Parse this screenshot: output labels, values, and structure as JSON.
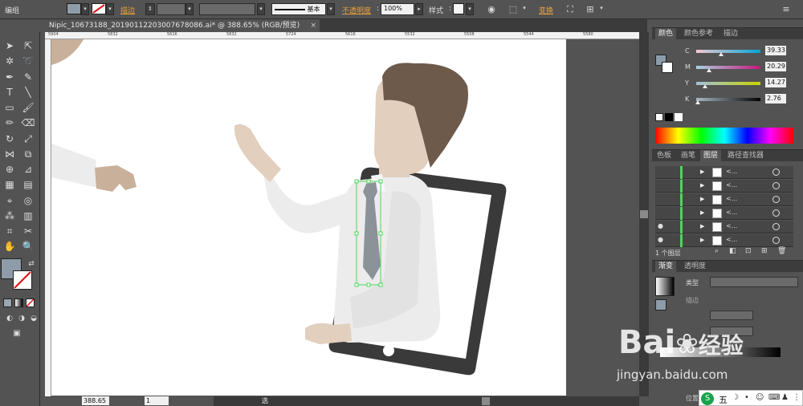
{
  "control_bar": {
    "group_label": "编组",
    "stroke_label": "描边",
    "stroke_style": "基本",
    "opacity_label": "不透明度",
    "opacity_value": "100%",
    "style_label": "样式",
    "transform_label": "变换",
    "fill_color": "#8d9ca8"
  },
  "document": {
    "tab_title": "Nipic_10673188_20190112203007678086.ai* @ 388.65% (RGB/预览)",
    "close_glyph": "×"
  },
  "ruler": {
    "ticks": [
      "5904",
      "5832",
      "5616",
      "5832",
      "5724",
      "5616",
      "5532",
      "5508",
      "5544",
      "5580"
    ]
  },
  "status": {
    "zoom": "388.65",
    "artboard": "1",
    "tool": "选择"
  },
  "color_panel": {
    "tabs": [
      "颜色",
      "颜色参考",
      "描边"
    ],
    "channels": [
      {
        "name": "C",
        "value": "39.33",
        "pos": 0.39
      },
      {
        "name": "M",
        "value": "20.29",
        "pos": 0.2
      },
      {
        "name": "Y",
        "value": "14.27",
        "pos": 0.14
      },
      {
        "name": "K",
        "value": "2.76",
        "pos": 0.03
      }
    ]
  },
  "layers_panel": {
    "tabs": [
      "色板",
      "画笔",
      "图层",
      "路径查找器"
    ],
    "rows": [
      {
        "eye": "",
        "name": "<..."
      },
      {
        "eye": "",
        "name": "<..."
      },
      {
        "eye": "",
        "name": "<..."
      },
      {
        "eye": "",
        "name": "<..."
      },
      {
        "eye": "●",
        "name": "<..."
      },
      {
        "eye": "●",
        "name": "<..."
      }
    ],
    "footer_text": "1 个图层"
  },
  "gradient_panel": {
    "tabs": [
      "渐变",
      "透明度"
    ],
    "type_label": "类型",
    "stroke_label": "描边",
    "location_label": "位置"
  },
  "watermark": {
    "brand": "Bai",
    "brand_tail": "经验",
    "url": "jingyan.baidu.com"
  },
  "ime": {
    "mode": "五"
  },
  "colors": {
    "hair": "#6e5a4a",
    "skin": "#e2cfbd",
    "shirt": "#ececec",
    "tie": "#8b9399",
    "tablet": "#3a3a3a",
    "selection": "#4bd65a"
  }
}
